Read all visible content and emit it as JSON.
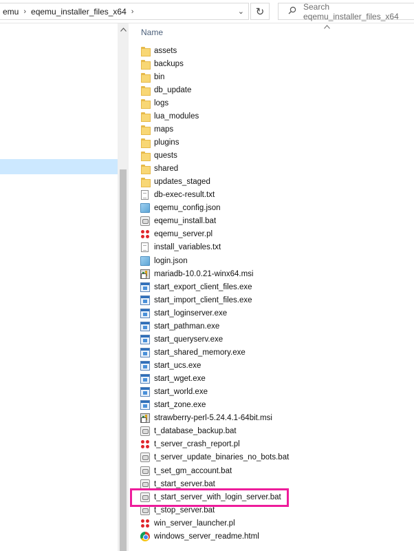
{
  "address_bar": {
    "crumbs": [
      "emu",
      "eqemu_installer_files_x64"
    ],
    "separator": "›",
    "dropdown": "⌄",
    "refresh": "↻"
  },
  "search": {
    "placeholder": "Search eqemu_installer_files_x64"
  },
  "content": {
    "column_name": "Name",
    "sort_arrow": "^"
  },
  "files": [
    {
      "name": "assets",
      "icon": "folder-icon"
    },
    {
      "name": "backups",
      "icon": "folder-icon"
    },
    {
      "name": "bin",
      "icon": "folder-icon"
    },
    {
      "name": "db_update",
      "icon": "folder-icon"
    },
    {
      "name": "logs",
      "icon": "folder-icon"
    },
    {
      "name": "lua_modules",
      "icon": "folder-icon"
    },
    {
      "name": "maps",
      "icon": "folder-icon"
    },
    {
      "name": "plugins",
      "icon": "folder-icon"
    },
    {
      "name": "quests",
      "icon": "folder-icon"
    },
    {
      "name": "shared",
      "icon": "folder-icon"
    },
    {
      "name": "updates_staged",
      "icon": "folder-icon"
    },
    {
      "name": "db-exec-result.txt",
      "icon": "text-file-icon"
    },
    {
      "name": "eqemu_config.json",
      "icon": "json-file-icon"
    },
    {
      "name": "eqemu_install.bat",
      "icon": "batch-file-icon"
    },
    {
      "name": "eqemu_server.pl",
      "icon": "perl-file-icon"
    },
    {
      "name": "install_variables.txt",
      "icon": "text-file-icon"
    },
    {
      "name": "login.json",
      "icon": "json-file-icon"
    },
    {
      "name": "mariadb-10.0.21-winx64.msi",
      "icon": "msi-file-icon"
    },
    {
      "name": "start_export_client_files.exe",
      "icon": "exe-file-icon"
    },
    {
      "name": "start_import_client_files.exe",
      "icon": "exe-file-icon"
    },
    {
      "name": "start_loginserver.exe",
      "icon": "exe-file-icon"
    },
    {
      "name": "start_pathman.exe",
      "icon": "exe-file-icon"
    },
    {
      "name": "start_queryserv.exe",
      "icon": "exe-file-icon"
    },
    {
      "name": "start_shared_memory.exe",
      "icon": "exe-file-icon"
    },
    {
      "name": "start_ucs.exe",
      "icon": "exe-file-icon"
    },
    {
      "name": "start_wget.exe",
      "icon": "exe-file-icon"
    },
    {
      "name": "start_world.exe",
      "icon": "exe-file-icon"
    },
    {
      "name": "start_zone.exe",
      "icon": "exe-file-icon"
    },
    {
      "name": "strawberry-perl-5.24.4.1-64bit.msi",
      "icon": "msi-file-icon"
    },
    {
      "name": "t_database_backup.bat",
      "icon": "batch-file-icon"
    },
    {
      "name": "t_server_crash_report.pl",
      "icon": "perl-file-icon"
    },
    {
      "name": "t_server_update_binaries_no_bots.bat",
      "icon": "batch-file-icon"
    },
    {
      "name": "t_set_gm_account.bat",
      "icon": "batch-file-icon"
    },
    {
      "name": "t_start_server.bat",
      "icon": "batch-file-icon"
    },
    {
      "name": "t_start_server_with_login_server.bat",
      "icon": "batch-file-icon",
      "highlighted": true
    },
    {
      "name": "t_stop_server.bat",
      "icon": "batch-file-icon"
    },
    {
      "name": "win_server_launcher.pl",
      "icon": "perl-file-icon"
    },
    {
      "name": "windows_server_readme.html",
      "icon": "chrome-html-icon"
    }
  ],
  "colors": {
    "selection": "#cce8ff",
    "highlight_box": "#ee1c9b",
    "column_header": "#4c607a"
  }
}
